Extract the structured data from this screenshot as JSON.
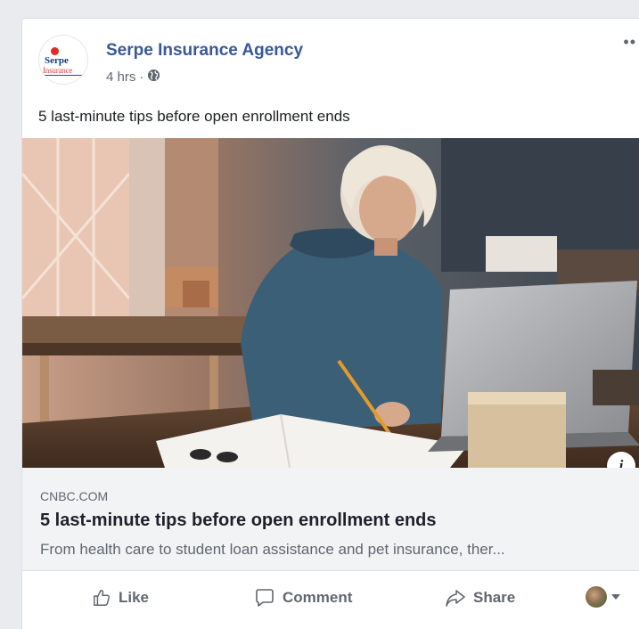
{
  "post": {
    "page_name": "Serpe Insurance Agency",
    "time": "4 hrs",
    "separator": "·",
    "audience_icon": "globe-icon",
    "more_label": "••",
    "text": "5 last-minute tips before open enrollment ends",
    "logo": {
      "line1": "Serpe",
      "line2": "Insurance"
    }
  },
  "link": {
    "domain": "CNBC.COM",
    "title": "5 last-minute tips before open enrollment ends",
    "description": "From health care to student loan assistance and pet insurance, ther...",
    "info_label": "i"
  },
  "actions": {
    "like": "Like",
    "comment": "Comment",
    "share": "Share"
  },
  "colors": {
    "page_name": "#385898",
    "secondary_text": "#606770",
    "link_box_bg": "#f2f3f5",
    "feed_bg": "#e9ebee"
  }
}
